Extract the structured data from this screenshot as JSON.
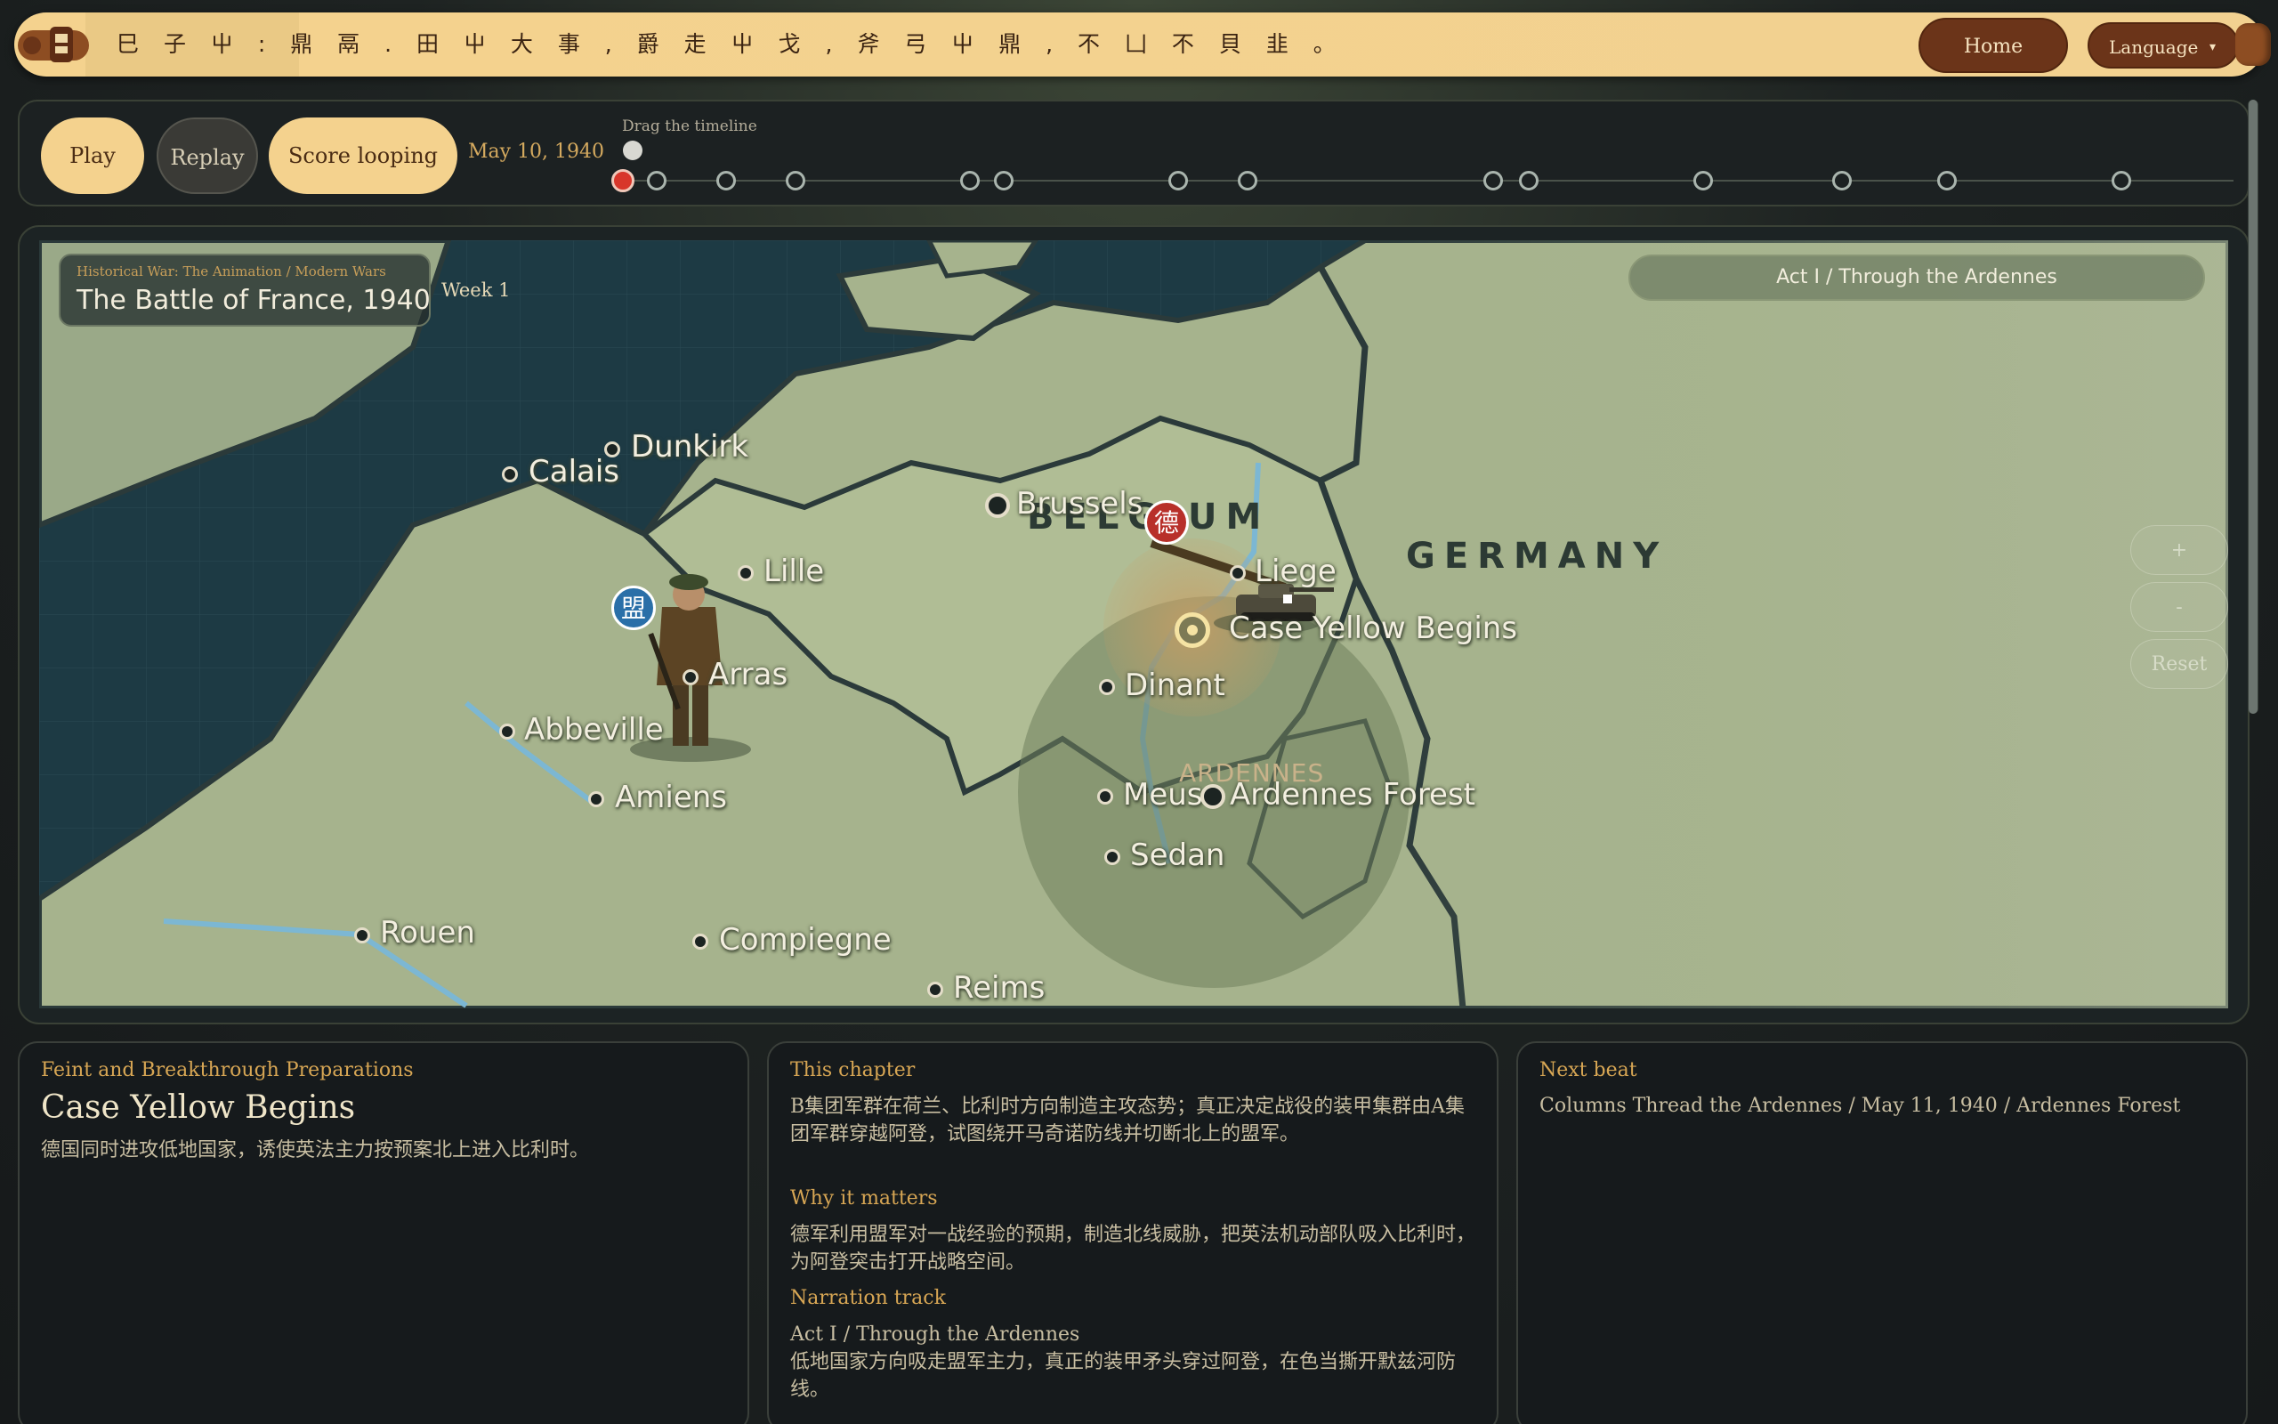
{
  "topbar": {
    "ticker": "⺒ 子 ⼬ : 鼎 鬲 . ⽥ ⼬ ⼤ 事 , 爵 ⾛ ⼬ 戈 , 斧 ⼸ ⼬ 鼎 , 不 ⼐ 不 ⾙ ⾲ 。",
    "home_label": "Home",
    "language_label": "Language",
    "language_caret": "▾"
  },
  "timeline": {
    "play_label": "Play",
    "replay_label": "Replay",
    "loop_label": "Score looping",
    "current_date": "May 10, 1940",
    "drag_hint": "Drag the timeline"
  },
  "map": {
    "series_label": "Historical War: The Animation / Modern Wars",
    "title": "The Battle of France, 1940",
    "week_label": "Week 1",
    "act_label": "Act I / Through the Ardennes",
    "zoom_in_label": "+",
    "zoom_out_label": "-",
    "reset_label": "Reset",
    "countries": {
      "belgium": "BELGIUM",
      "germany": "GERMANY"
    },
    "region_label": "ARDENNES",
    "german_faction": "德",
    "allied_faction": "盟",
    "event_label": "Case Yellow Begins",
    "cities": {
      "calais": "Calais",
      "dunkirk": "Dunkirk",
      "brussels": "Brussels",
      "lille": "Lille",
      "liege": "Liege",
      "arras": "Arras",
      "dinant": "Dinant",
      "abbeville": "Abbeville",
      "amiens": "Amiens",
      "meuse": "Meuse",
      "ardennes_forest": "Ardennes Forest",
      "sedan": "Sedan",
      "rouen": "Rouen",
      "compiegne": "Compiegne",
      "reims": "Reims"
    }
  },
  "info": {
    "left": {
      "kicker": "Feint and Breakthrough Preparations",
      "title": "Case Yellow Begins",
      "description": "德国同时进攻低地国家，诱使英法主力按预案北上进入比利时。"
    },
    "middle": {
      "chapter_heading": "This chapter",
      "chapter_text": "B集团军群在荷兰、比利时方向制造主攻态势；真正决定战役的装甲集群由A集团军群穿越阿登，试图绕开马奇诺防线并切断北上的盟军。",
      "matters_heading": "Why it matters",
      "matters_text": "德军利用盟军对一战经验的预期，制造北线威胁，把英法机动部队吸入比利时，为阿登突击打开战略空间。",
      "narration_heading": "Narration track",
      "narration_title": "Act I / Through the Ardennes",
      "narration_text": "低地国家方向吸走盟军主力，真正的装甲矛头穿过阿登，在色当撕开默兹河防线。"
    },
    "right": {
      "kicker": "Next beat",
      "text": "Columns Thread the Ardennes / May 11, 1940 / Ardennes Forest"
    }
  },
  "colors": {
    "accent_gold": "#f4d28e",
    "accent_brown": "#6b3419",
    "kicker_gold": "#d7a654",
    "german_red": "#b8302a",
    "allied_blue": "#2a6fa8"
  }
}
